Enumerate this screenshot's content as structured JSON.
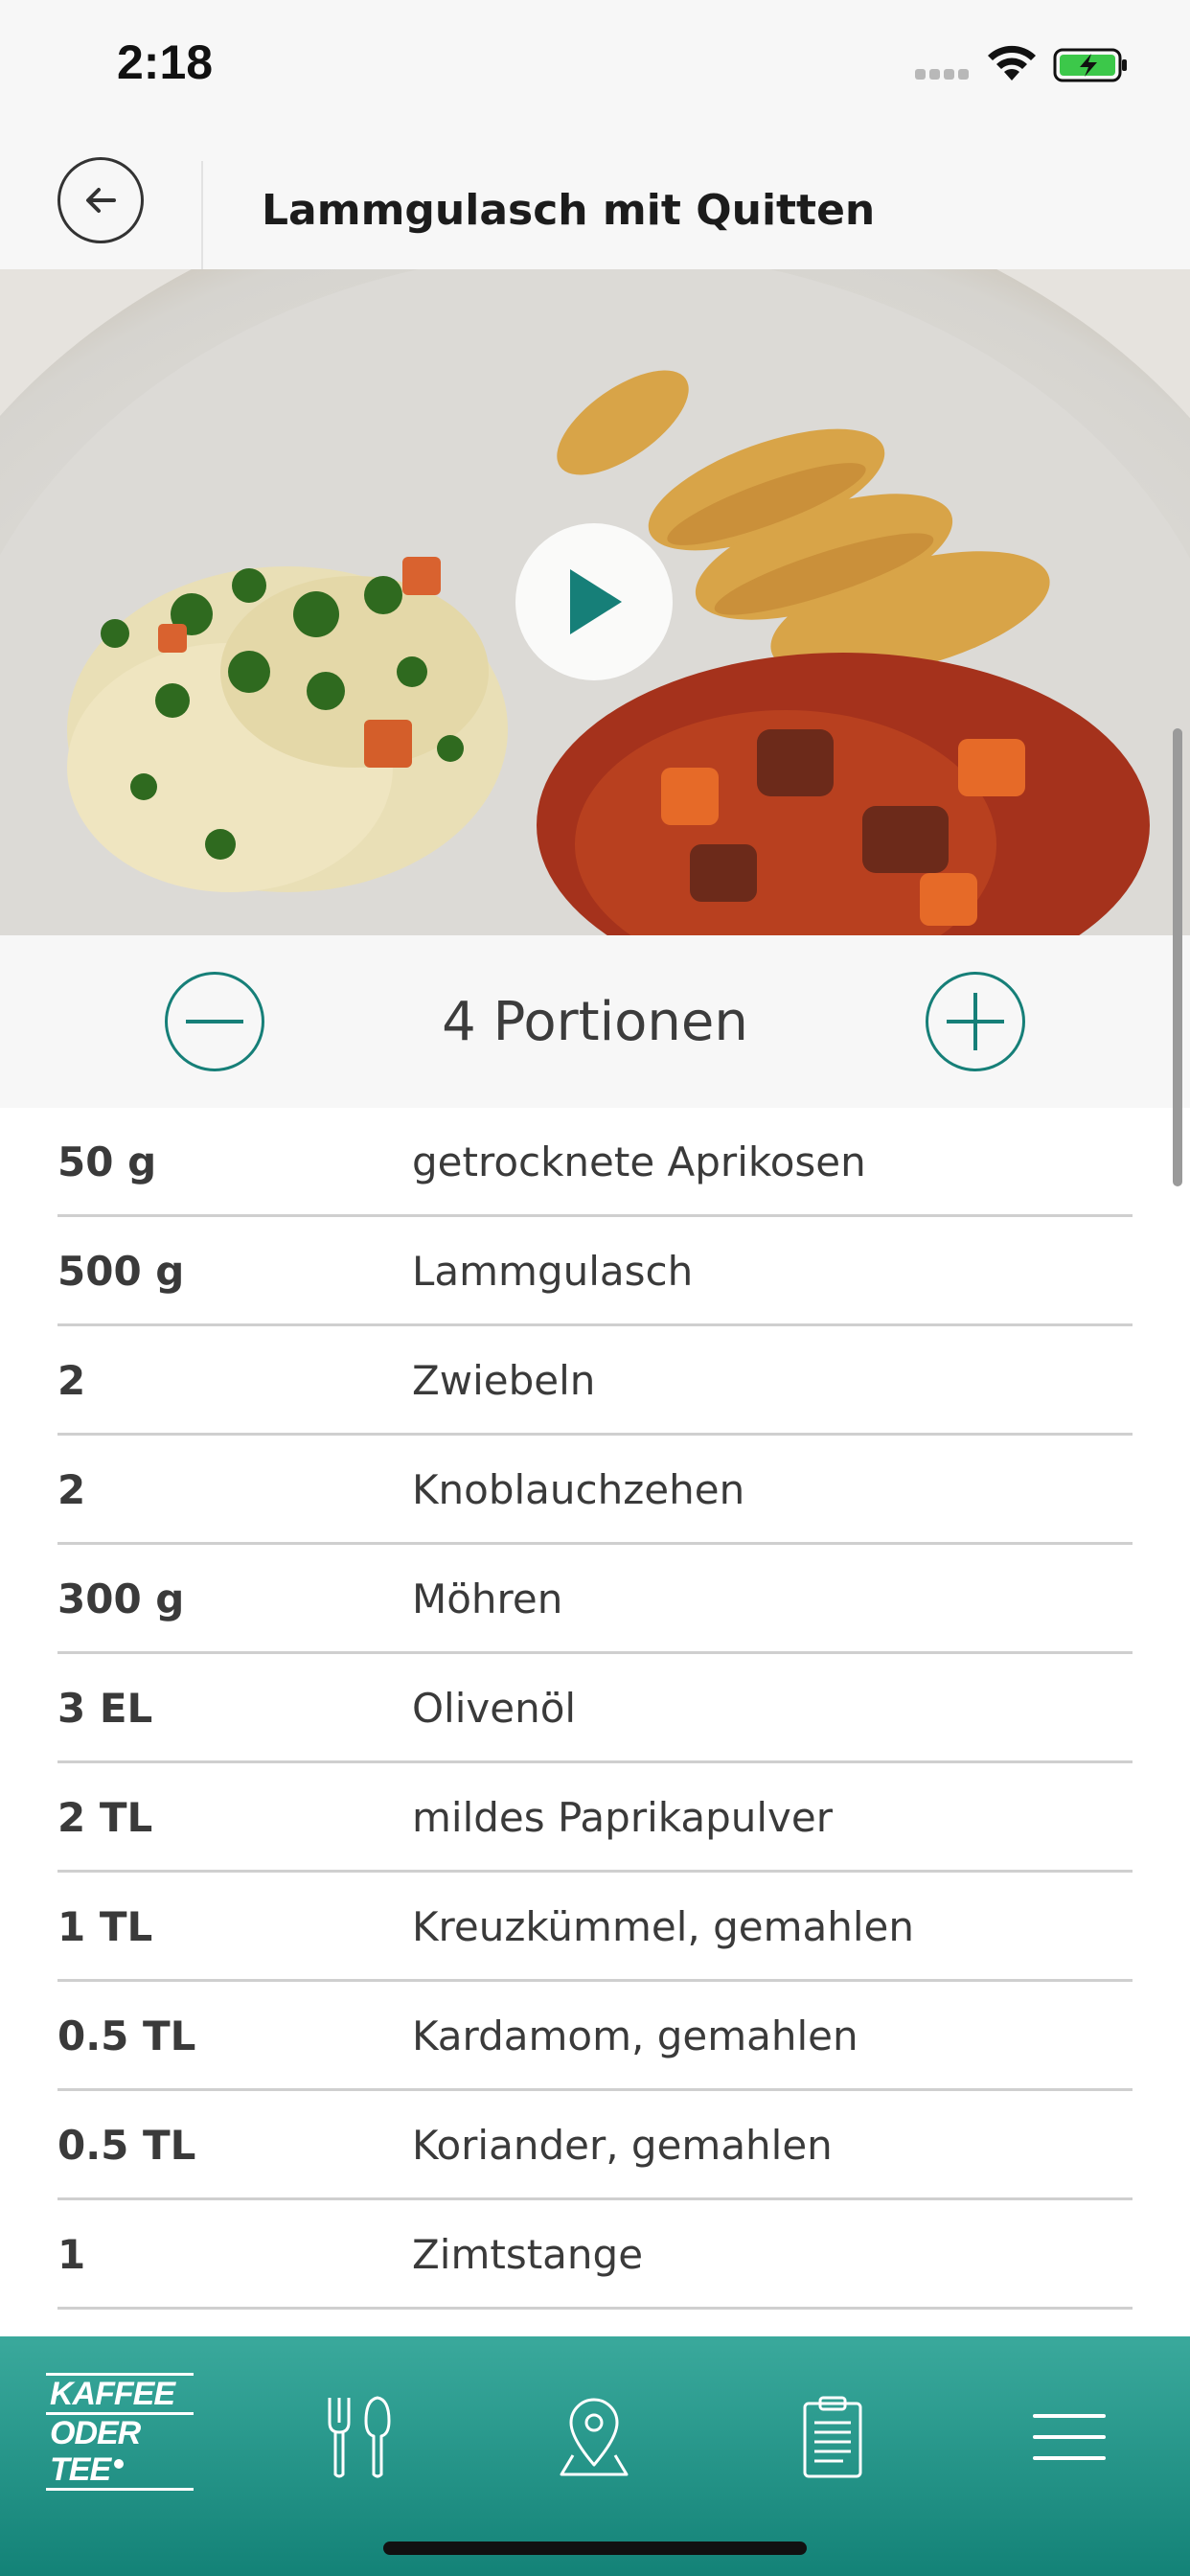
{
  "status_bar": {
    "time": "2:18"
  },
  "nav": {
    "title": "Lammgulasch mit Quitten"
  },
  "portions": {
    "label": "4 Portionen"
  },
  "ingredients": [
    {
      "amount": "50 g",
      "name": "getrocknete Aprikosen"
    },
    {
      "amount": "500 g",
      "name": "Lammgulasch"
    },
    {
      "amount": "2",
      "name": "Zwiebeln"
    },
    {
      "amount": "2",
      "name": "Knoblauchzehen"
    },
    {
      "amount": "300 g",
      "name": "Möhren"
    },
    {
      "amount": "3 EL",
      "name": "Olivenöl"
    },
    {
      "amount": "2 TL",
      "name": "mildes Paprikapulver"
    },
    {
      "amount": "1 TL",
      "name": "Kreuzkümmel, gemahlen"
    },
    {
      "amount": "0.5 TL",
      "name": "Kardamom, gemahlen"
    },
    {
      "amount": "0.5 TL",
      "name": "Koriander, gemahlen"
    },
    {
      "amount": "1",
      "name": "Zimtstange"
    }
  ],
  "tab_bar": {
    "logo_line1": "KAFFEE",
    "logo_line2": "ODER TEE",
    "icons": [
      "cutlery-icon",
      "map-pin-icon",
      "clipboard-icon",
      "menu-icon"
    ]
  },
  "colors": {
    "accent": "#167f78",
    "tab_bar_top": "#3aa99c",
    "tab_bar_bottom": "#138277",
    "battery": "#3cc84a"
  }
}
